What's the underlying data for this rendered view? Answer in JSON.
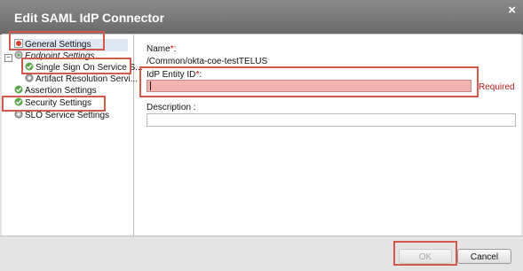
{
  "dialog": {
    "title": "Edit SAML IdP Connector",
    "close_symbol": "×"
  },
  "tree": {
    "expand_symbol": "−",
    "items": [
      {
        "label": "General Settings",
        "icon": "settings-icon-red",
        "selected": true
      },
      {
        "label": "Endpoint Settings",
        "icon": "endpoint-icon"
      },
      {
        "label": "Single Sign On Service S...",
        "icon": "check-icon-green"
      },
      {
        "label": "Artifact Resolution Servi...",
        "icon": "gear-icon"
      },
      {
        "label": "Assertion Settings",
        "icon": "check-icon-green"
      },
      {
        "label": "Security Settings",
        "icon": "check-icon-green"
      },
      {
        "label": "SLO Service Settings",
        "icon": "gear-icon"
      }
    ]
  },
  "form": {
    "name_label": "Name",
    "required_mark": "*",
    "name_colon": ":",
    "name_value": "/Common/okta-coe-testTELUS",
    "entity_label": "IdP Entity ID",
    "entity_colon": ":",
    "entity_value": "",
    "required_text": "Required",
    "description_label": "Description",
    "description_colon": " :",
    "description_value": ""
  },
  "footer": {
    "ok_label": "OK",
    "cancel_label": "Cancel"
  },
  "colors": {
    "highlight": "#d35a4a",
    "required_field_bg": "#f4b3ae",
    "title_bar": "#7a7a7a"
  }
}
